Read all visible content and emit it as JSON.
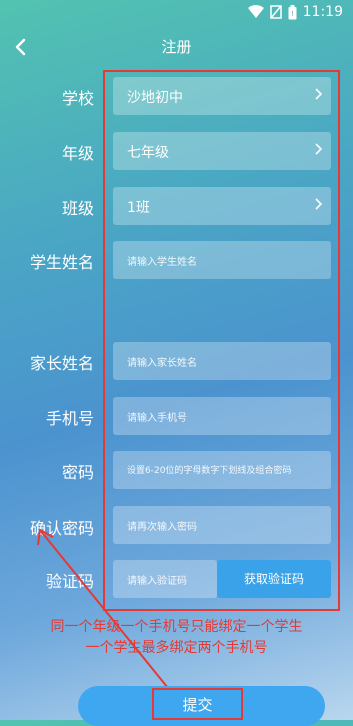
{
  "status": {
    "time": "11:19"
  },
  "header": {
    "title": "注册"
  },
  "form": {
    "school": {
      "label": "学校",
      "value": "沙地初中"
    },
    "grade": {
      "label": "年级",
      "value": "七年级"
    },
    "class": {
      "label": "班级",
      "value": "1班"
    },
    "student_name": {
      "label": "学生姓名",
      "placeholder": "请输入学生姓名"
    },
    "parent_name": {
      "label": "家长姓名",
      "placeholder": "请输入家长姓名"
    },
    "phone": {
      "label": "手机号",
      "placeholder": "请输入手机号"
    },
    "password": {
      "label": "密码",
      "placeholder": "设置6-20位的字母数字下划线及组合密码"
    },
    "confirm_password": {
      "label": "确认密码",
      "placeholder": "请再次输入密码"
    },
    "verify_code": {
      "label": "验证码",
      "placeholder": "请输入验证码",
      "button": "获取验证码"
    }
  },
  "annotation": {
    "line1": "同一个年级一个手机号只能绑定一个学生",
    "line2": "一个学生最多绑定两个手机号"
  },
  "submit": {
    "label": "提交"
  },
  "colors": {
    "annotation": "#e53935",
    "button": "#3aa2e8"
  }
}
